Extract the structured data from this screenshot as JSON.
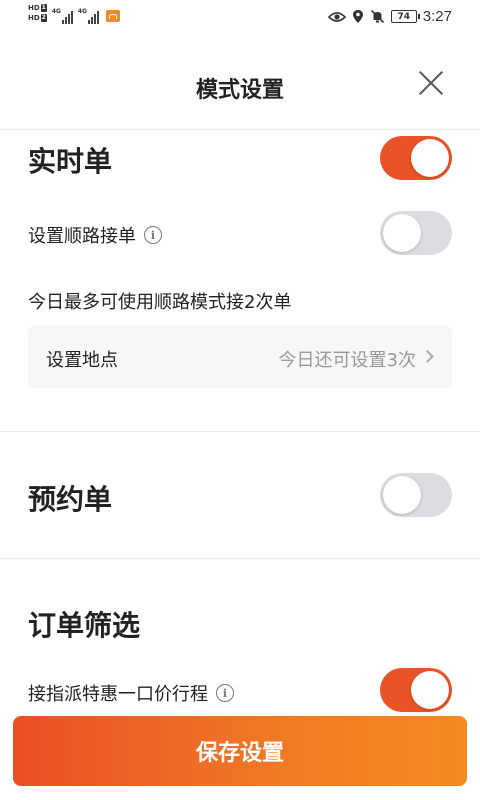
{
  "status_bar": {
    "sim1": "HD",
    "sim1_index": "1",
    "sim2": "HD",
    "sim2_index": "2",
    "net1": "4G",
    "net2": "4G",
    "battery": "74",
    "time": "3:27",
    "icons": [
      "eye-icon",
      "location-icon",
      "mute-bell-icon",
      "battery-icon"
    ]
  },
  "header": {
    "title": "模式设置",
    "close_icon": "close-icon"
  },
  "realtime": {
    "title": "实时单",
    "enabled": true,
    "route_label": "设置顺路接单",
    "route_enabled": false,
    "route_limit_text": "今日最多可使用顺路模式接2次单",
    "location_label": "设置地点",
    "location_remaining": "今日还可设置3次"
  },
  "reservation": {
    "title": "预约单",
    "enabled": false
  },
  "filter": {
    "title": "订单筛选",
    "assign_label": "接指派特惠一口价行程",
    "assign_enabled": true
  },
  "save_button": {
    "label": "保存设置"
  },
  "colors": {
    "accent": "#ea5327",
    "toggle_off": "#dcdde0",
    "button_gradient_start": "#ea4f28",
    "button_gradient_end": "#f58a20"
  }
}
